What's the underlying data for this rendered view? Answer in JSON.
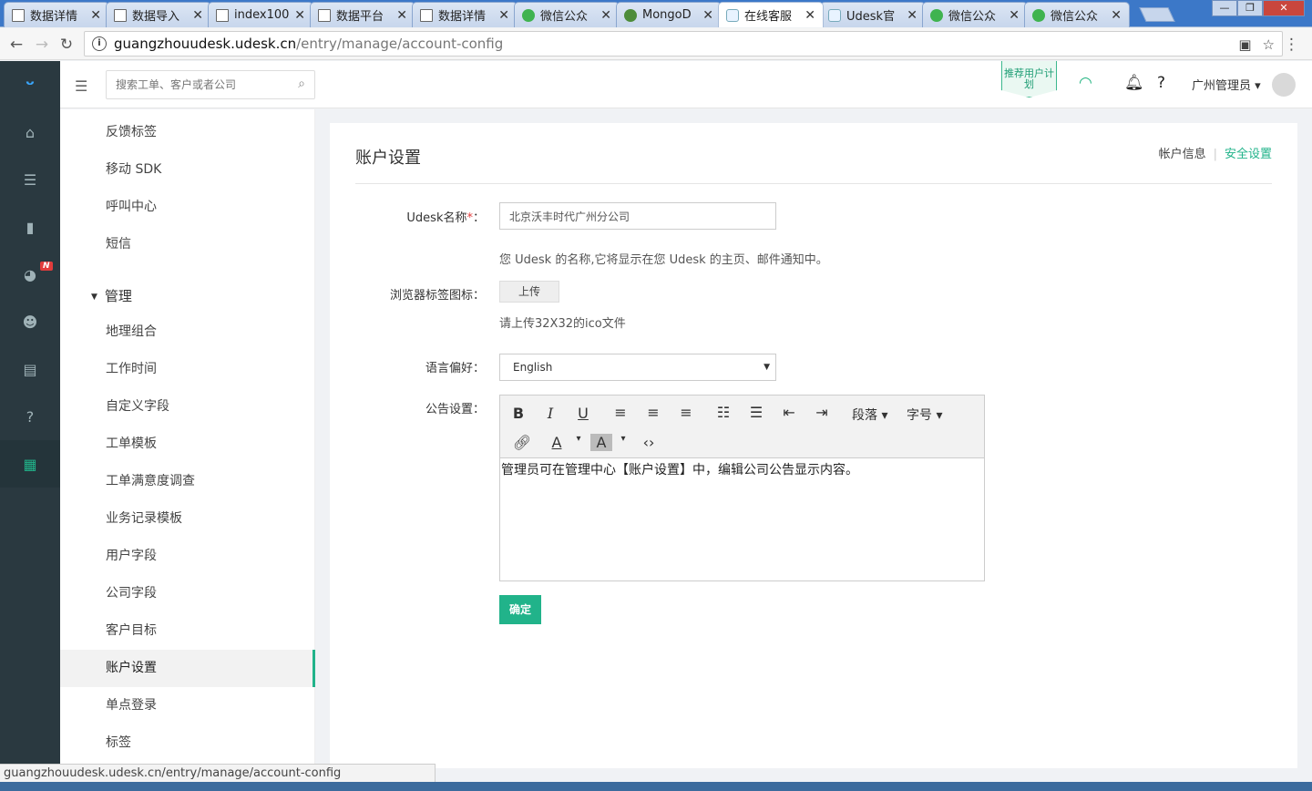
{
  "browser": {
    "tabs": [
      {
        "title": "数据详情",
        "icon": "doc"
      },
      {
        "title": "数据导入",
        "icon": "doc"
      },
      {
        "title": "index100",
        "icon": "doc"
      },
      {
        "title": "数据平台",
        "icon": "doc"
      },
      {
        "title": "数据详情",
        "icon": "doc"
      },
      {
        "title": "微信公众",
        "icon": "wx"
      },
      {
        "title": "MongoD",
        "icon": "mg"
      },
      {
        "title": "在线客服",
        "icon": "ud",
        "active": true
      },
      {
        "title": "Udesk官",
        "icon": "ud"
      },
      {
        "title": "微信公众",
        "icon": "wx"
      },
      {
        "title": "微信公众",
        "icon": "wx"
      }
    ],
    "url_host": "guangzhouudesk.udesk.cn",
    "url_path": "/entry/manage/account-config",
    "status_url": "guangzhouudesk.udesk.cn/entry/manage/account-config"
  },
  "header": {
    "search_placeholder": "搜索工单、客户或者公司",
    "promo": "推荐用户计划",
    "user_name": "广州管理员",
    "nav_badge": "N"
  },
  "submenu": {
    "items_top": [
      "反馈标签",
      "移动 SDK",
      "呼叫中心",
      "短信"
    ],
    "group": "管理",
    "items": [
      "地理组合",
      "工作时间",
      "自定义字段",
      "工单模板",
      "工单满意度调查",
      "业务记录模板",
      "用户字段",
      "公司字段",
      "客户目标",
      "账户设置",
      "单点登录",
      "标签"
    ],
    "active": "账户设置"
  },
  "page": {
    "title": "账户设置",
    "tab_info": "帐户信息",
    "tab_security": "安全设置",
    "name_label": "Udesk名称",
    "name_required": "*",
    "name_colon": "：",
    "name_value": "北京沃丰时代广州分公司",
    "name_hint": "您 Udesk 的名称,它将显示在您 Udesk 的主页、邮件通知中。",
    "favicon_label": "浏览器标签图标：",
    "upload_label": "上传",
    "favicon_hint": "请上传32X32的ico文件",
    "lang_label": "语言偏好：",
    "lang_value": "English",
    "notice_label": "公告设置：",
    "editor_paragraph": "段落",
    "editor_fontsize": "字号",
    "notice_text": "管理员可在管理中心【账户设置】中，编辑公司公告显示内容。",
    "submit_label": "确定"
  },
  "colors": {
    "accent": "#21b38a",
    "sidebar": "#2a3940"
  }
}
